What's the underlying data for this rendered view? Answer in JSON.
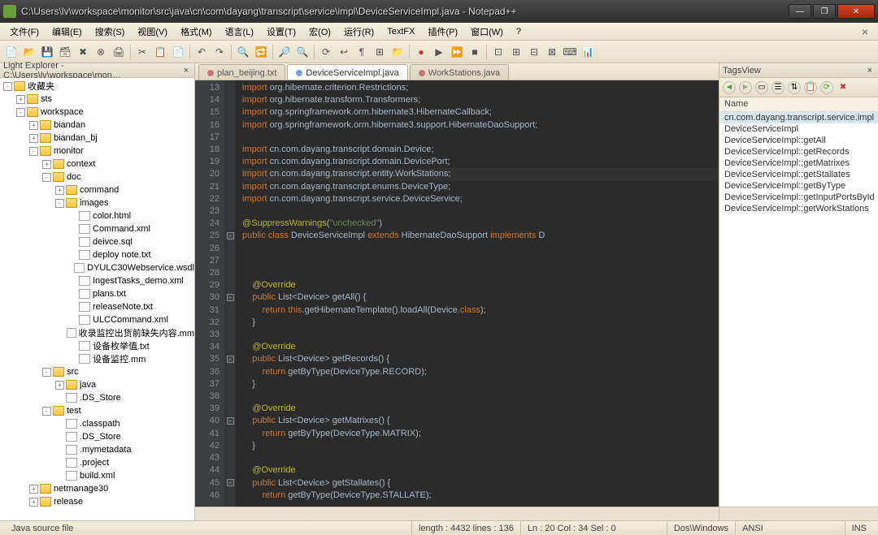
{
  "window": {
    "title": "C:\\Users\\lv\\workspace\\monitor\\src\\java\\cn\\com\\dayang\\transcript\\service\\impl\\DeviceServiceImpl.java - Notepad++"
  },
  "menu": [
    "文件(F)",
    "编辑(E)",
    "搜索(S)",
    "视图(V)",
    "格式(M)",
    "语言(L)",
    "设置(T)",
    "宏(O)",
    "运行(R)",
    "TextFX",
    "插件(P)",
    "窗口(W)",
    "?"
  ],
  "sidebar": {
    "title": "Light Explorer - C:\\Users\\lv\\workspace\\mon…",
    "tree": [
      {
        "d": 0,
        "e": "-",
        "t": "folder",
        "l": "收藏夹"
      },
      {
        "d": 1,
        "e": "+",
        "t": "folder",
        "l": "sts"
      },
      {
        "d": 1,
        "e": "-",
        "t": "folder",
        "l": "workspace"
      },
      {
        "d": 2,
        "e": "+",
        "t": "folder",
        "l": "biandan"
      },
      {
        "d": 2,
        "e": "+",
        "t": "folder",
        "l": "biandan_bj"
      },
      {
        "d": 2,
        "e": "-",
        "t": "folder",
        "l": "monitor"
      },
      {
        "d": 3,
        "e": "+",
        "t": "folder",
        "l": "context"
      },
      {
        "d": 3,
        "e": "-",
        "t": "folder",
        "l": "doc"
      },
      {
        "d": 4,
        "e": "+",
        "t": "folder",
        "l": "command"
      },
      {
        "d": 4,
        "e": "-",
        "t": "folder",
        "l": "images"
      },
      {
        "d": 5,
        "e": " ",
        "t": "file",
        "l": "color.html"
      },
      {
        "d": 5,
        "e": " ",
        "t": "file",
        "l": "Command.xml"
      },
      {
        "d": 5,
        "e": " ",
        "t": "file",
        "l": "deivce.sql"
      },
      {
        "d": 5,
        "e": " ",
        "t": "file",
        "l": "deploy note.txt"
      },
      {
        "d": 5,
        "e": " ",
        "t": "file",
        "l": "DYULC30Webservice.wsdl"
      },
      {
        "d": 5,
        "e": " ",
        "t": "file",
        "l": "IngestTasks_demo.xml"
      },
      {
        "d": 5,
        "e": " ",
        "t": "file",
        "l": "plans.txt"
      },
      {
        "d": 5,
        "e": " ",
        "t": "file",
        "l": "releaseNote.txt"
      },
      {
        "d": 5,
        "e": " ",
        "t": "file",
        "l": "ULCCommand.xml"
      },
      {
        "d": 5,
        "e": " ",
        "t": "file",
        "l": "收录监控出货前缺失内容.mm"
      },
      {
        "d": 5,
        "e": " ",
        "t": "file",
        "l": "设备枚举值.txt"
      },
      {
        "d": 5,
        "e": " ",
        "t": "file",
        "l": "设备监控.mm"
      },
      {
        "d": 3,
        "e": "-",
        "t": "folder",
        "l": "src"
      },
      {
        "d": 4,
        "e": "+",
        "t": "folder",
        "l": "java"
      },
      {
        "d": 4,
        "e": " ",
        "t": "file",
        "l": ".DS_Store"
      },
      {
        "d": 3,
        "e": "-",
        "t": "folder",
        "l": "test"
      },
      {
        "d": 4,
        "e": " ",
        "t": "file",
        "l": ".classpath"
      },
      {
        "d": 4,
        "e": " ",
        "t": "file",
        "l": ".DS_Store"
      },
      {
        "d": 4,
        "e": " ",
        "t": "file",
        "l": ".mymetadata"
      },
      {
        "d": 4,
        "e": " ",
        "t": "file",
        "l": ".project"
      },
      {
        "d": 4,
        "e": " ",
        "t": "file",
        "l": "build.xml"
      },
      {
        "d": 2,
        "e": "+",
        "t": "folder",
        "l": "netmanage30"
      },
      {
        "d": 2,
        "e": "+",
        "t": "folder",
        "l": "release"
      }
    ]
  },
  "tabs": [
    {
      "label": "plan_beijing.txt",
      "active": false
    },
    {
      "label": "DeviceServiceImpl.java",
      "active": true
    },
    {
      "label": "WorkStations.java",
      "active": false
    }
  ],
  "code": {
    "start": 13,
    "lines": [
      {
        "h": "<span class='kw'>import</span> <span class='pkg'>org.hibernate.criterion.Restrictions;</span>"
      },
      {
        "h": "<span class='kw'>import</span> <span class='pkg'>org.hibernate.transform.Transformers;</span>"
      },
      {
        "h": "<span class='kw'>import</span> <span class='pkg'>org.springframework.orm.hibernate3.HibernateCallback;</span>"
      },
      {
        "h": "<span class='kw'>import</span> <span class='pkg'>org.springframework.orm.hibernate3.support.HibernateDaoSupport;</span>"
      },
      {
        "h": ""
      },
      {
        "h": "<span class='kw'>import</span> <span class='pkg'>cn.com.dayang.transcript.domain.Device;</span>"
      },
      {
        "h": "<span class='kw'>import</span> <span class='pkg'>cn.com.dayang.transcript.domain.DevicePort;</span>"
      },
      {
        "h": "<span class='kw'>import</span> <span class='pkg'>cn.com.dayang.transcript.entity.WorkStations;</span>",
        "hl": true
      },
      {
        "h": "<span class='kw'>import</span> <span class='pkg'>cn.com.dayang.transcript.enums.DeviceType;</span>"
      },
      {
        "h": "<span class='kw'>import</span> <span class='pkg'>cn.com.dayang.transcript.service.DeviceService;</span>"
      },
      {
        "h": ""
      },
      {
        "h": "<span class='ann'>@SuppressWarnings</span><span class='typ'>(</span><span class='str'>\"unchecked\"</span><span class='typ'>)</span>"
      },
      {
        "h": "<span class='kw'>public class</span> <span class='typ'>DeviceServiceImpl </span><span class='kw'>extends</span><span class='typ'> HibernateDaoSupport </span><span class='kw'>implements</span><span class='typ'> D</span>",
        "fold": "-"
      },
      {
        "h": ""
      },
      {
        "h": ""
      },
      {
        "h": ""
      },
      {
        "h": "    <span class='ann'>@Override</span>"
      },
      {
        "h": "    <span class='kw'>public</span> <span class='typ'>List&lt;Device&gt; getAll() {</span>",
        "fold": "-"
      },
      {
        "h": "        <span class='kw'>return</span> <span class='kw'>this</span><span class='typ'>.getHibernateTemplate().loadAll(Device.</span><span class='kw'>class</span><span class='typ'>);</span>"
      },
      {
        "h": "    <span class='typ'>}</span>"
      },
      {
        "h": ""
      },
      {
        "h": "    <span class='ann'>@Override</span>"
      },
      {
        "h": "    <span class='kw'>public</span> <span class='typ'>List&lt;Device&gt; getRecords() {</span>",
        "fold": "-"
      },
      {
        "h": "        <span class='kw'>return</span> <span class='typ'>getByType(DeviceType.RECORD);</span>"
      },
      {
        "h": "    <span class='typ'>}</span>"
      },
      {
        "h": ""
      },
      {
        "h": "    <span class='ann'>@Override</span>"
      },
      {
        "h": "    <span class='kw'>public</span> <span class='typ'>List&lt;Device&gt; getMatrixes() {</span>",
        "fold": "-"
      },
      {
        "h": "        <span class='kw'>return</span> <span class='typ'>getByType(DeviceType.MATRIX);</span>"
      },
      {
        "h": "    <span class='typ'>}</span>"
      },
      {
        "h": ""
      },
      {
        "h": "    <span class='ann'>@Override</span>"
      },
      {
        "h": "    <span class='kw'>public</span> <span class='typ'>List&lt;Device&gt; getStallates() {</span>",
        "fold": "-"
      },
      {
        "h": "        <span class='kw'>return</span> <span class='typ'>getByType(DeviceType.STALLATE);</span>"
      }
    ]
  },
  "tags": {
    "title": "TagsView",
    "header": "Name",
    "items": [
      "cn.com.dayang.transcript.service.impl",
      "DeviceServiceImpl",
      "DeviceServiceImpl::getAll",
      "DeviceServiceImpl::getRecords",
      "DeviceServiceImpl::getMatrixes",
      "DeviceServiceImpl::getStallates",
      "DeviceServiceImpl::getByType",
      "DeviceServiceImpl::getInputPortsById",
      "DeviceServiceImpl::getWorkStations"
    ]
  },
  "status": {
    "type": "Java source file",
    "length": "length : 4432    lines : 136",
    "pos": "Ln : 20   Col : 34   Sel : 0",
    "eol": "Dos\\Windows",
    "enc": "ANSI",
    "mode": "INS"
  }
}
